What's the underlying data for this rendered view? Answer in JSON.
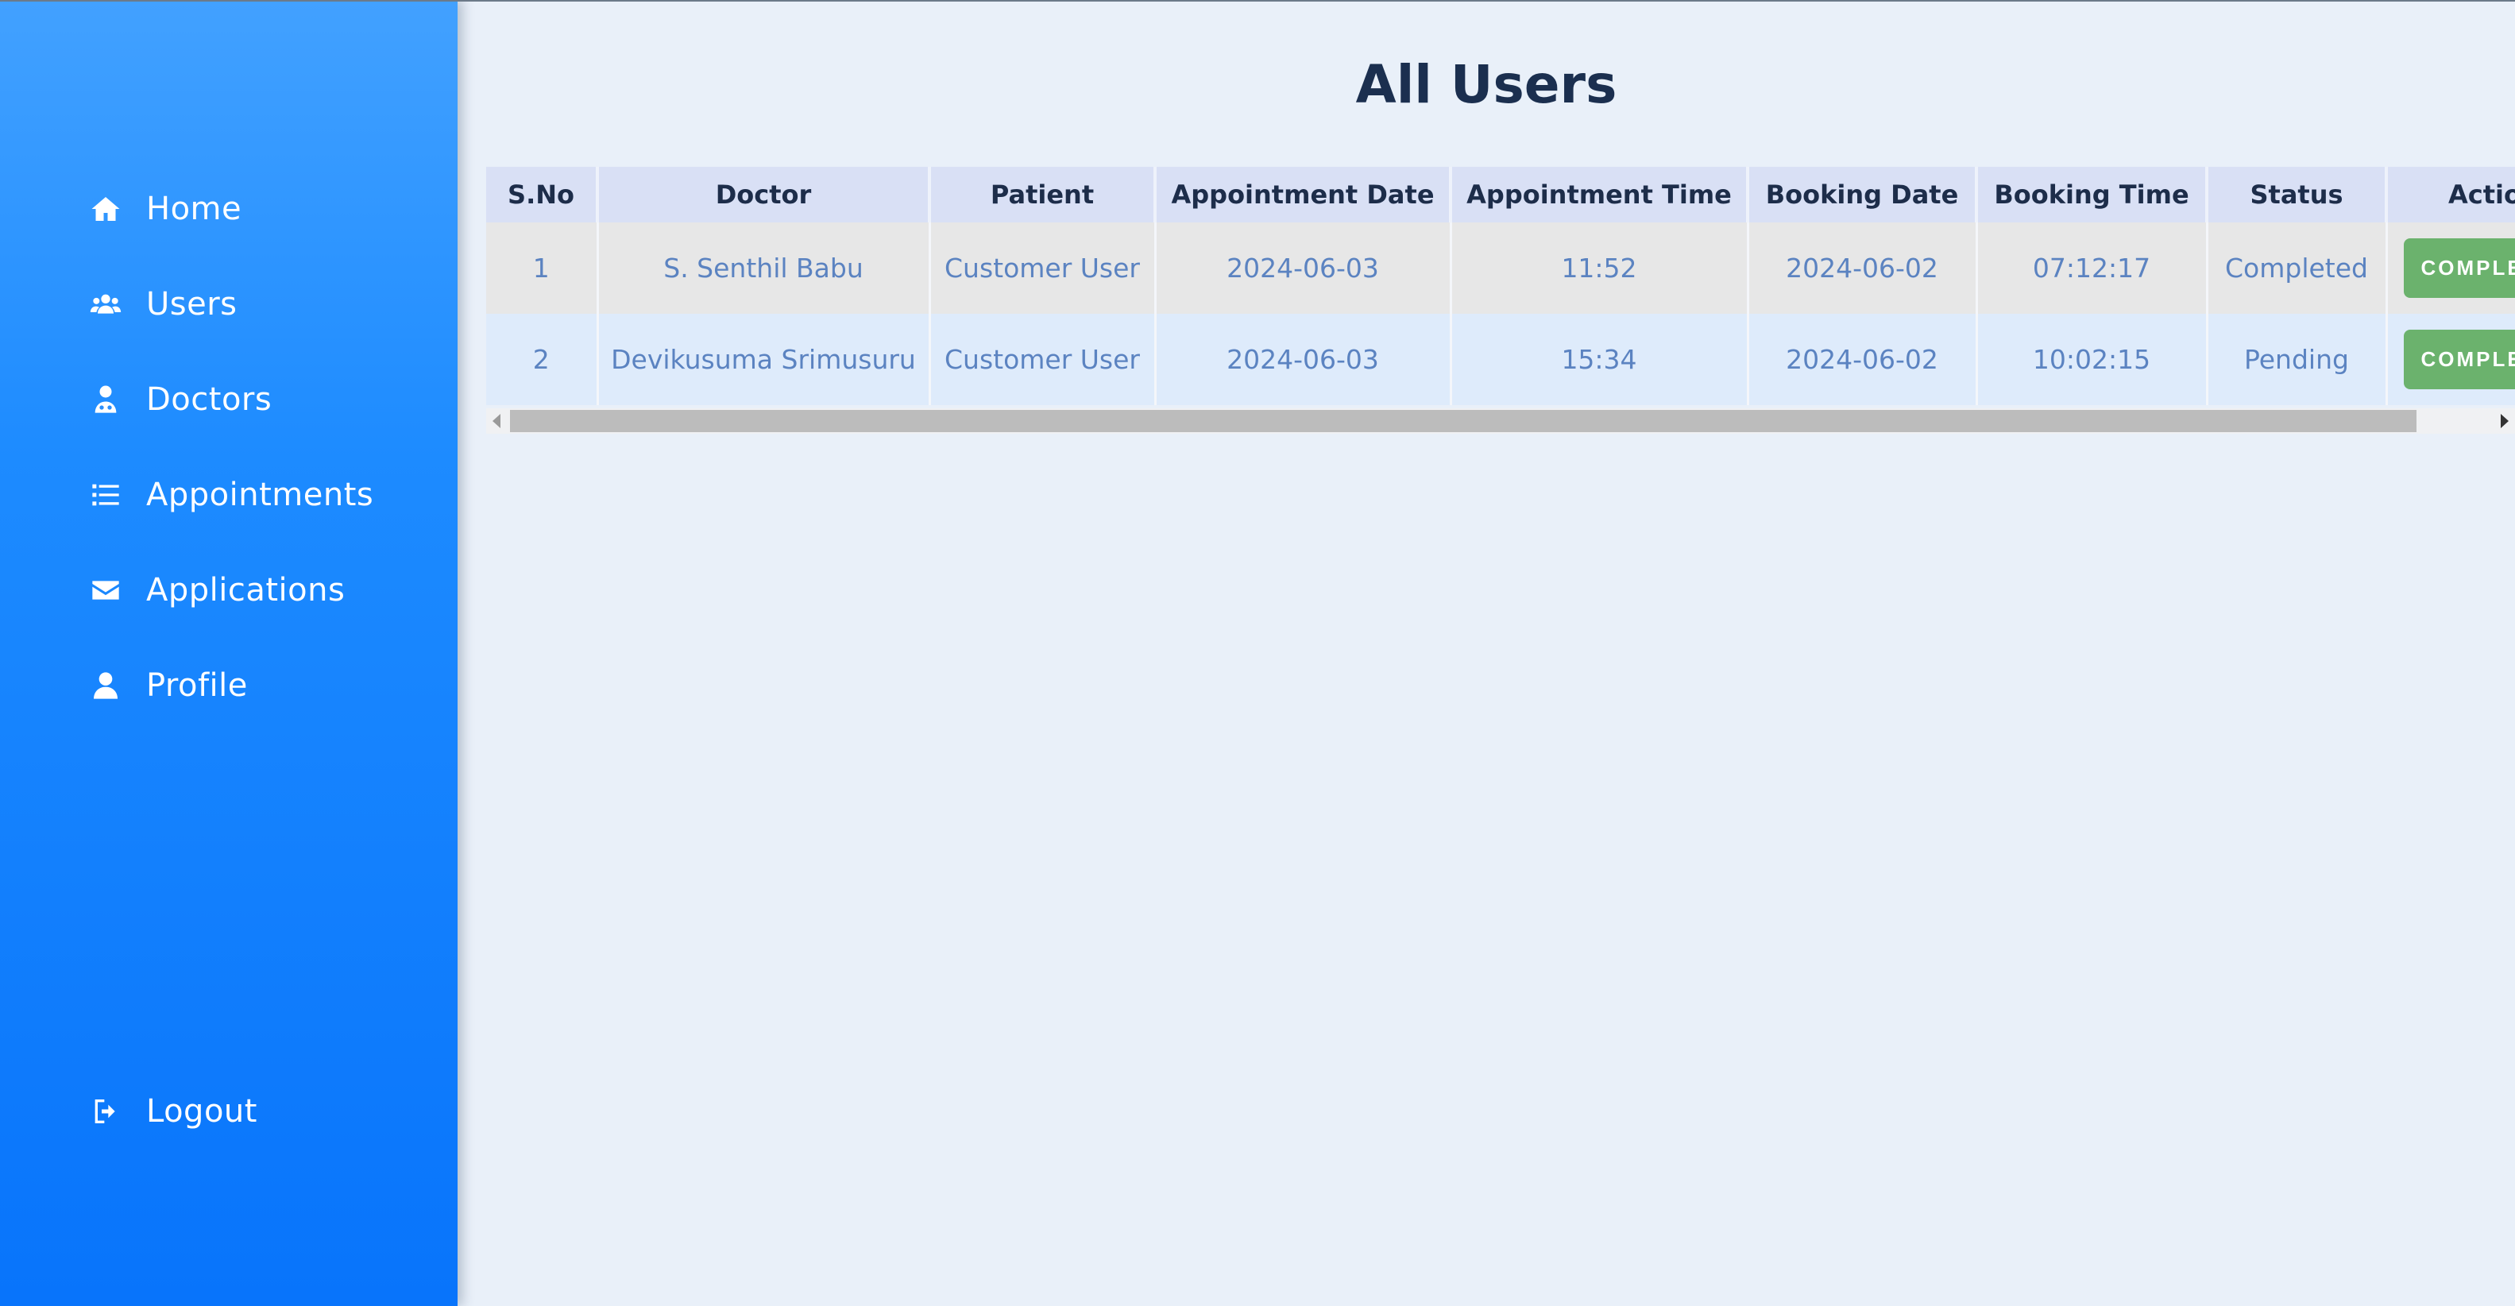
{
  "sidebar": {
    "items": [
      {
        "label": "Home",
        "icon": "home-icon"
      },
      {
        "label": "Users",
        "icon": "users-icon"
      },
      {
        "label": "Doctors",
        "icon": "doctor-icon"
      },
      {
        "label": "Appointments",
        "icon": "list-icon"
      },
      {
        "label": "Applications",
        "icon": "envelope-icon"
      },
      {
        "label": "Profile",
        "icon": "user-icon"
      }
    ],
    "logout": {
      "label": "Logout",
      "icon": "logout-icon"
    }
  },
  "main": {
    "title": "All Users",
    "table": {
      "headers": [
        "S.No",
        "Doctor",
        "Patient",
        "Appointment Date",
        "Appointment Time",
        "Booking Date",
        "Booking Time",
        "Status",
        "Action"
      ],
      "rows": [
        {
          "sno": "1",
          "doctor": "S. Senthil Babu",
          "patient": "Customer User",
          "appointment_date": "2024-06-03",
          "appointment_time": "11:52",
          "booking_date": "2024-06-02",
          "booking_time": "07:12:17",
          "status": "Completed",
          "action": "COMPLETE"
        },
        {
          "sno": "2",
          "doctor": "Devikusuma Srimusuru",
          "patient": "Customer User",
          "appointment_date": "2024-06-03",
          "appointment_time": "15:34",
          "booking_date": "2024-06-02",
          "booking_time": "10:02:15",
          "status": "Pending",
          "action": "COMPLETE"
        }
      ]
    }
  },
  "colors": {
    "sidebar_top": "#42a1ff",
    "sidebar_bottom": "#0874fb",
    "page_bg": "#e9f0f9",
    "header_bg": "#d9e0f5",
    "action_button": "#6bb26d",
    "title_text": "#1b2f4f",
    "cell_text": "#5b83c1"
  }
}
